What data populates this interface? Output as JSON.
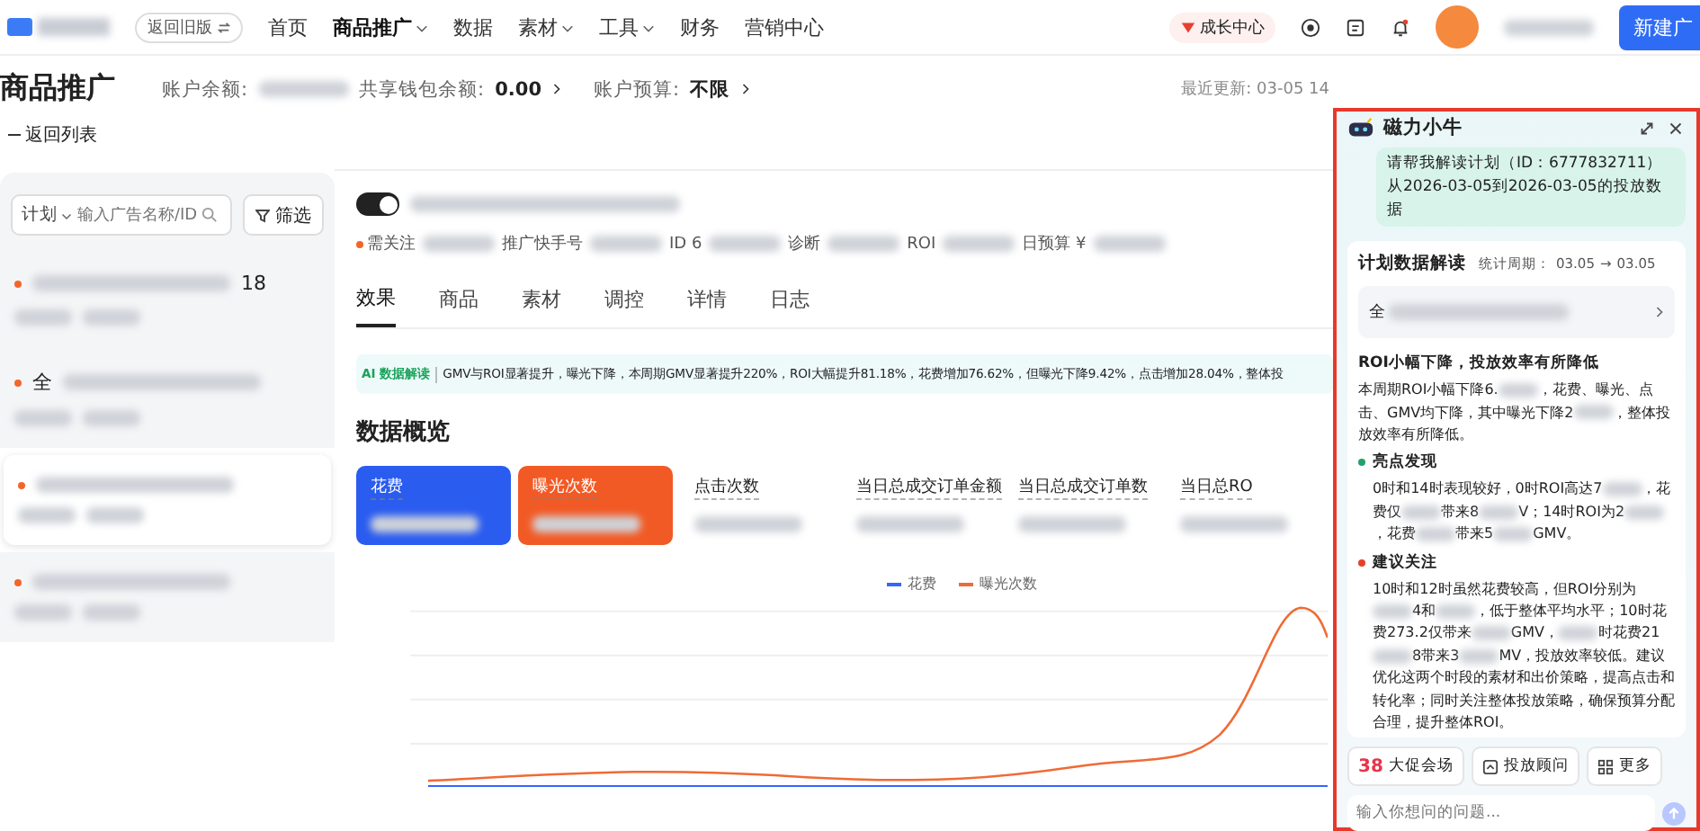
{
  "nav": {
    "back_old": "返回旧版",
    "items": [
      {
        "label": "首页",
        "selected": false,
        "dropdown": false
      },
      {
        "label": "商品推广",
        "selected": true,
        "dropdown": true
      },
      {
        "label": "数据",
        "selected": false,
        "dropdown": false
      },
      {
        "label": "素材",
        "selected": false,
        "dropdown": true
      },
      {
        "label": "工具",
        "selected": false,
        "dropdown": true
      },
      {
        "label": "财务",
        "selected": false,
        "dropdown": false
      },
      {
        "label": "营销中心",
        "selected": false,
        "dropdown": false
      }
    ],
    "growth": "成长中心",
    "create_button": "新建广"
  },
  "header": {
    "title": "商品推广",
    "balance_label": "账户余额:",
    "wallet_label": "共享钱包余额:",
    "wallet_value": "0.00",
    "budget_label": "账户预算:",
    "budget_value": "不限",
    "updated": "最近更新: 03-05 14"
  },
  "back_link": "返回列表",
  "sidebar": {
    "scope": "计划",
    "search_placeholder": "输入广告名称/ID",
    "filter": "筛选",
    "items": [
      {
        "suffix": "18",
        "selected": false
      },
      {
        "prefix": "全",
        "selected": false
      },
      {
        "selected": true
      },
      {
        "selected": false
      }
    ]
  },
  "plan": {
    "enabled": true,
    "meta": [
      {
        "label": "需关注",
        "alert": true
      },
      {
        "label": "推广快手号",
        "alert": false
      },
      {
        "label": "ID 6",
        "alert": false
      },
      {
        "label": "诊断",
        "alert": false
      },
      {
        "label": "ROI",
        "alert": false
      },
      {
        "label": "日预算 ¥",
        "alert": false
      }
    ]
  },
  "tabs": [
    {
      "label": "效果",
      "selected": true
    },
    {
      "label": "商品",
      "selected": false
    },
    {
      "label": "素材",
      "selected": false
    },
    {
      "label": "调控",
      "selected": false
    },
    {
      "label": "详情",
      "selected": false
    },
    {
      "label": "日志",
      "selected": false
    }
  ],
  "banner": {
    "tag": "AI 数据解读",
    "text": "GMV与ROI显著提升，曝光下降，本周期GMV显著提升220%，ROI大幅提升81.18%，花费增加76.62%，但曝光下降9.42%，点击增加28.04%，整体投"
  },
  "overview": {
    "title": "数据概览",
    "metrics": [
      {
        "label": "花费",
        "selected": true,
        "color": "#2a5cf0"
      },
      {
        "label": "曝光次数",
        "selected": true,
        "color": "#f25a25"
      },
      {
        "label": "点击次数",
        "selected": false
      },
      {
        "label": "当日总成交订单金额",
        "selected": false
      },
      {
        "label": "当日总成交订单数",
        "selected": false
      },
      {
        "label": "当日总RO",
        "selected": false
      }
    ],
    "legend": [
      {
        "label": "花费",
        "color": "#3366ff"
      },
      {
        "label": "曝光次数",
        "color": "#f06a35"
      }
    ]
  },
  "assistant": {
    "title": "磁力小牛",
    "question": "请帮我解读计划（ID：6777832711）从2026-03-05到2026-03-05的投放数据",
    "card_title": "计划数据解读",
    "period_label": "统计周期：",
    "period_start": "03.05",
    "period_arrow": "→",
    "period_end": "03.05",
    "plan_prefix": "全",
    "headline": "ROI小幅下降，投放效率有所降低",
    "summary": [
      "本周期ROI小幅下降6.",
      "，花费、曝光、点击、GMV均下降，其中曝光下降2",
      "，整体投放效率有所降低。"
    ],
    "sections": [
      {
        "title": "亮点发现",
        "color": "#22a06b",
        "parts": [
          "0时和14时表现较好，0时ROI高达7",
          "，花费仅",
          "带来8",
          "V；14时ROI为2",
          "，花费",
          "带来5",
          "GMV。"
        ]
      },
      {
        "title": "建议关注",
        "color": "#e5402b",
        "parts": [
          "10时和12时虽然花费较高，但ROI分别为",
          "4和",
          "，低于整体平均水平；10时花费273.2仅带来",
          "GMV，",
          "时花费21",
          "8带来3",
          "MV，投放效率较低。建议优化这两个时段的素材和出价策略，提高点击和转化率；同时关注整体投放策略，确保预算分配合理，提升整体ROI。"
        ]
      }
    ],
    "chips": [
      {
        "kind": "promo",
        "badge": "38",
        "label": "大促会场"
      },
      {
        "kind": "advisor",
        "label": "投放顾问"
      },
      {
        "kind": "more",
        "label": "更多"
      }
    ],
    "input_placeholder": "输入你想问的问题..."
  }
}
